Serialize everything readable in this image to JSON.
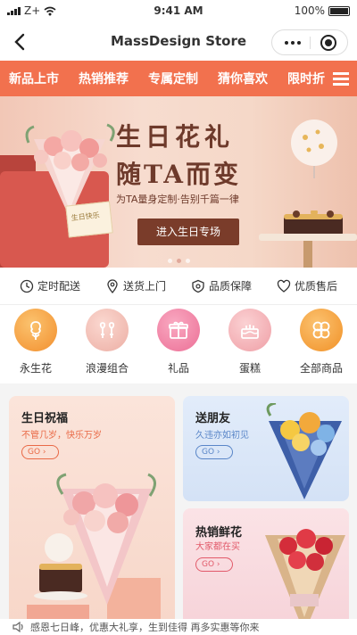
{
  "status_bar": {
    "carrier": "Z+",
    "time": "9:41 AM",
    "battery": "100%"
  },
  "nav": {
    "title": "MassDesign Store"
  },
  "tabs": [
    {
      "label": "新品上市"
    },
    {
      "label": "热销推荐"
    },
    {
      "label": "专属定制"
    },
    {
      "label": "猜你喜欢"
    },
    {
      "label": "限时折"
    }
  ],
  "banner": {
    "title_line1": "生日花礼",
    "title_line2": "随TA而变",
    "subtitle": "为TA量身定制·告别千篇一律",
    "cta": "进入生日专场",
    "card_text": "生日快乐",
    "slide_count": 3,
    "active_slide": 2
  },
  "features": [
    {
      "icon": "clock-icon",
      "label": "定时配送"
    },
    {
      "icon": "location-icon",
      "label": "送货上门"
    },
    {
      "icon": "shield-icon",
      "label": "品质保障"
    },
    {
      "icon": "heart-icon",
      "label": "优质售后"
    }
  ],
  "categories": [
    {
      "icon": "rose-icon",
      "label": "永生花",
      "color": "#f7a24a"
    },
    {
      "icon": "couple-icon",
      "label": "浪漫组合",
      "color": "#f2b7ae"
    },
    {
      "icon": "gift-icon",
      "label": "礼品",
      "color": "#f07ea0"
    },
    {
      "icon": "cake-icon",
      "label": "蛋糕",
      "color": "#f4b3b8"
    },
    {
      "icon": "clover-icon",
      "label": "全部商品",
      "color": "#f6a445"
    }
  ],
  "promos": [
    {
      "title": "生日祝福",
      "subtitle": "不管几岁，快乐万岁",
      "go": "GO"
    },
    {
      "title": "送朋友",
      "subtitle": "久违亦如初见",
      "go": "GO"
    },
    {
      "title": "热销鲜花",
      "subtitle": "大家都在买",
      "go": "GO"
    }
  ],
  "notice": {
    "text": "感恩七日峰，优惠大礼享，生到佳得 再多实惠等你来"
  }
}
